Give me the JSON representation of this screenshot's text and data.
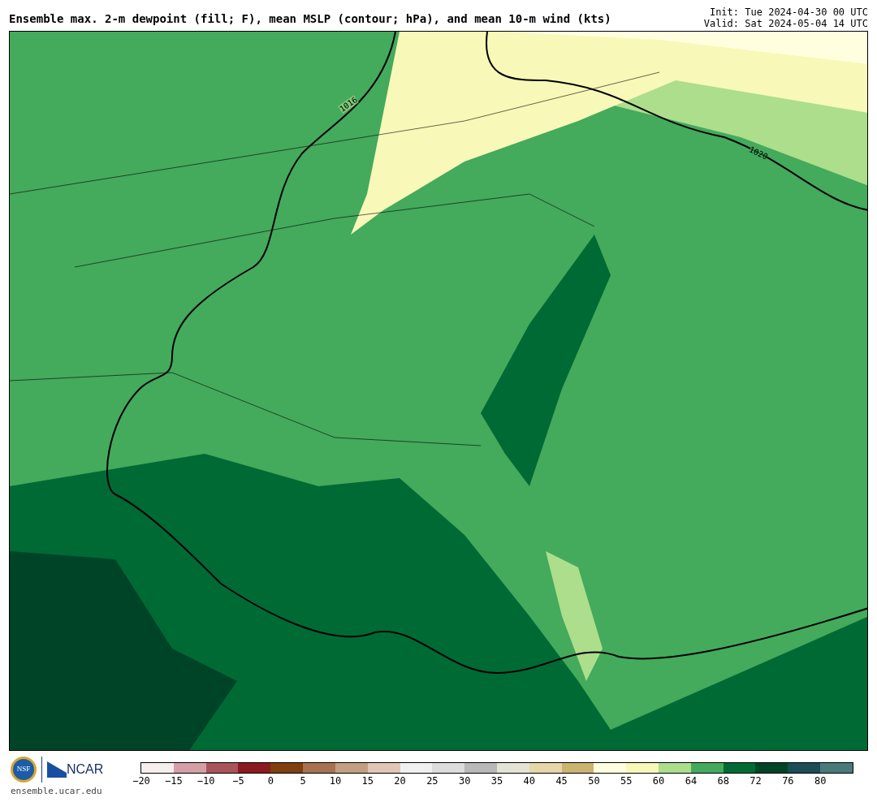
{
  "title": "Ensemble max. 2-m dewpoint (fill; F), mean MSLP (contour; hPa), and mean 10-m wind (kts)",
  "init": "Init: Tue 2024-04-30 00 UTC",
  "valid": "Valid: Sat 2024-05-04 14 UTC",
  "map": {
    "contour_labels": [
      {
        "text": "1016"
      },
      {
        "text": "1020"
      }
    ]
  },
  "logos": {
    "site": "ensemble.ucar.edu",
    "ncar": "NCAR",
    "nsf": "NSF"
  },
  "colorbar": {
    "segments": [
      {
        "color": "#f6eeee"
      },
      {
        "color": "#d4a0a4"
      },
      {
        "color": "#a8545a"
      },
      {
        "color": "#8b1a1e"
      },
      {
        "color": "#7f3f0f"
      },
      {
        "color": "#a87250"
      },
      {
        "color": "#c49e82"
      },
      {
        "color": "#e0c6b4"
      },
      {
        "color": "#f0f0f0"
      },
      {
        "color": "#dcdcdc"
      },
      {
        "color": "#b8b8b8"
      },
      {
        "color": "#e4e4d4"
      },
      {
        "color": "#e6d6a8"
      },
      {
        "color": "#ccb470"
      },
      {
        "color": "#ffffe0"
      },
      {
        "color": "#f8f8b8"
      },
      {
        "color": "#acde8c"
      },
      {
        "color": "#44aa5c"
      },
      {
        "color": "#006a34"
      },
      {
        "color": "#004428"
      },
      {
        "color": "#1c4c54"
      },
      {
        "color": "#4a7a7a"
      }
    ],
    "ticks": [
      "−20",
      "−15",
      "−10",
      "−5",
      "0",
      "5",
      "10",
      "15",
      "20",
      "25",
      "30",
      "35",
      "40",
      "45",
      "50",
      "55",
      "60",
      "64",
      "68",
      "72",
      "76",
      "80"
    ]
  }
}
